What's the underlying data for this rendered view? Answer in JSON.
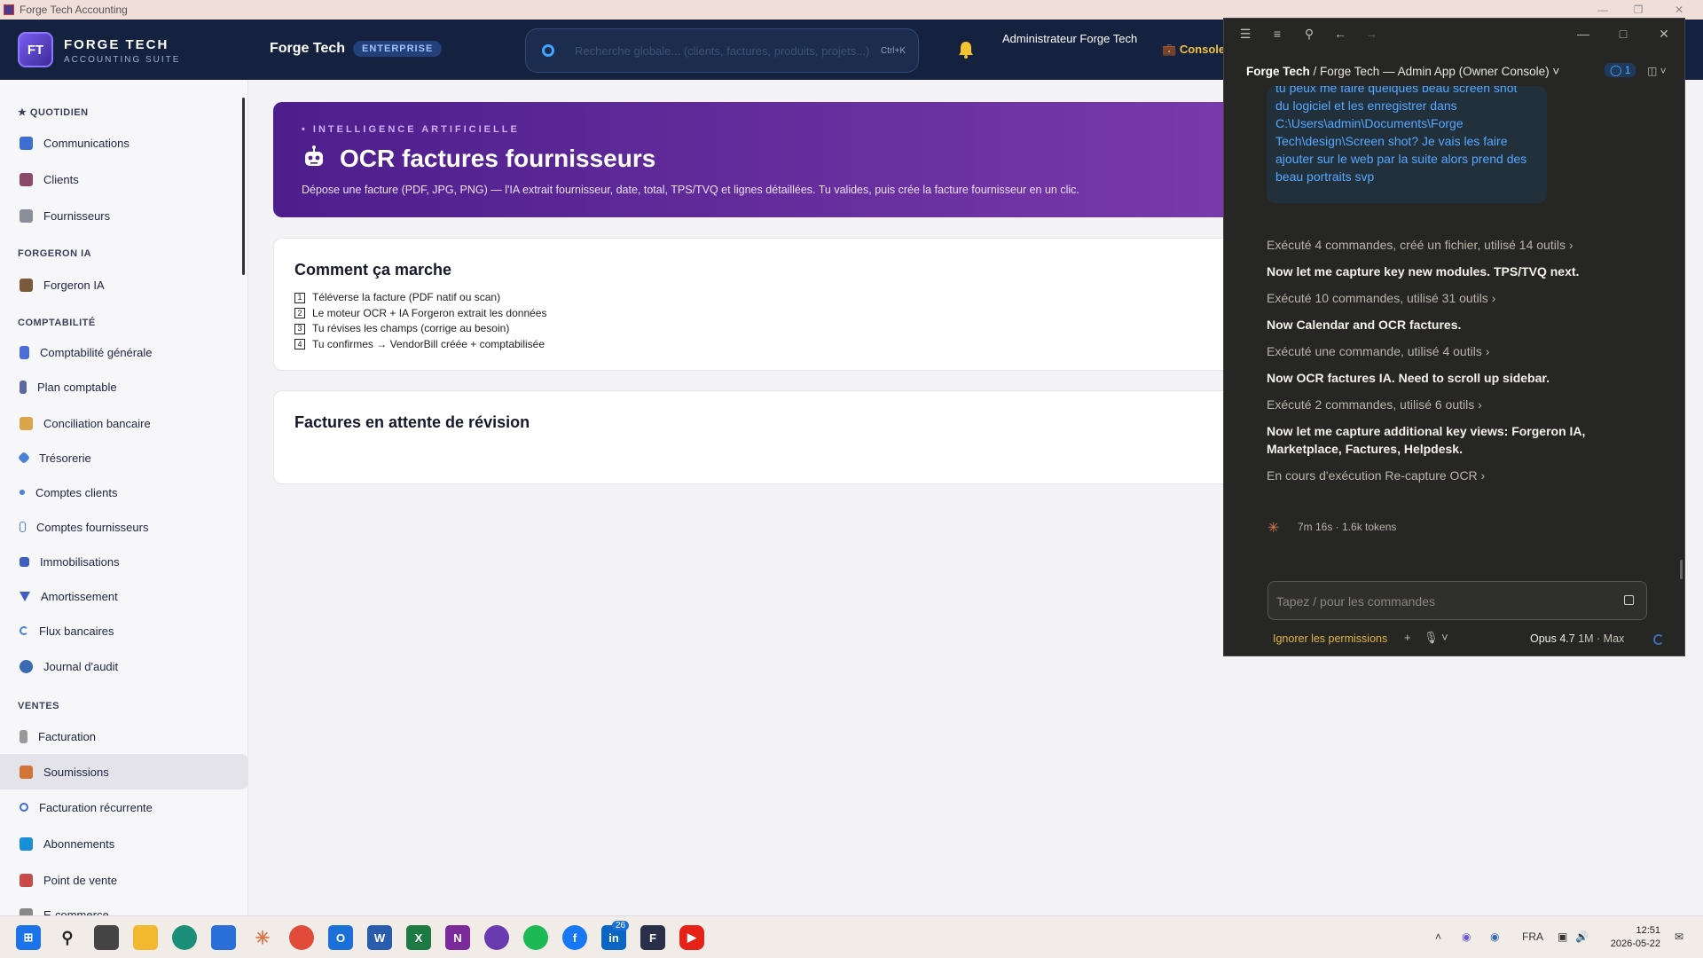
{
  "window": {
    "title": "Forge Tech Accounting"
  },
  "header": {
    "logo_title": "FORGE TECH",
    "logo_sub": "ACCOUNTING SUITE",
    "brand": "Forge Tech",
    "tier": "ENTERPRISE",
    "search_placeholder": "Recherche globale... (clients, factures, produits, projets...)",
    "search_shortcut": "Ctrl+K",
    "admin_name": "Administrateur Forge Tech",
    "console_label": "Console"
  },
  "sidebar": {
    "sections": [
      {
        "label": "★ QUOTIDIEN"
      },
      {
        "label": "FORGERON IA"
      },
      {
        "label": "COMPTABILITÉ"
      },
      {
        "label": "VENTES"
      }
    ],
    "items": [
      {
        "label": "Communications",
        "icon": "chat-icon",
        "color": "#3d6fd0"
      },
      {
        "label": "Clients",
        "icon": "users-icon",
        "color": "#8a4a6a"
      },
      {
        "label": "Fournisseurs",
        "icon": "building-icon",
        "color": "#8a8f9a"
      },
      {
        "label": "Forgeron IA",
        "icon": "hammer-icon",
        "color": "#7a5a3a"
      },
      {
        "label": "Comptabilité générale",
        "icon": "ledger-icon",
        "color": "#4a6fd8"
      },
      {
        "label": "Plan comptable",
        "icon": "list-icon",
        "color": "#5a6aa0"
      },
      {
        "label": "Conciliation bancaire",
        "icon": "scale-icon",
        "color": "#d9a44a"
      },
      {
        "label": "Trésorerie",
        "icon": "diamond-icon",
        "color": "#4a80d8"
      },
      {
        "label": "Comptes clients",
        "icon": "arrow-icon",
        "color": "#4a80d8"
      },
      {
        "label": "Comptes fournisseurs",
        "icon": "doc-icon",
        "color": "#4a80d8"
      },
      {
        "label": "Immobilisations",
        "icon": "block-icon",
        "color": "#3d5fc0"
      },
      {
        "label": "Amortissement",
        "icon": "triangle-down-icon",
        "color": "#3d5fc0"
      },
      {
        "label": "Flux bancaires",
        "icon": "refresh-icon",
        "color": "#4a80d8"
      },
      {
        "label": "Journal d'audit",
        "icon": "magnifier-icon",
        "color": "#3a6ab0"
      },
      {
        "label": "Facturation",
        "icon": "receipt-icon",
        "color": "#999"
      },
      {
        "label": "Soumissions",
        "icon": "memo-icon",
        "color": "#d0743a"
      },
      {
        "label": "Facturation récurrente",
        "icon": "recurring-icon",
        "color": "#3d6fd0"
      },
      {
        "label": "Abonnements",
        "icon": "subscription-icon",
        "color": "#1a8fd8"
      },
      {
        "label": "Point de vente",
        "icon": "pos-icon",
        "color": "#c84a4a"
      },
      {
        "label": "E-commerce",
        "icon": "cart-icon",
        "color": "#888"
      }
    ]
  },
  "hero": {
    "kicker": "• INTELLIGENCE ARTIFICIELLE",
    "title": "OCR factures fournisseurs",
    "desc": "Dépose une facture (PDF, JPG, PNG) — l'IA extrait fournisseur, date, total, TPS/TVQ et lignes détaillées. Tu valides, puis crée la facture fournisseur en un clic."
  },
  "how": {
    "title": "Comment ça marche",
    "steps": [
      {
        "n": "1",
        "text": "Téléverse la facture (PDF natif ou scan)"
      },
      {
        "n": "2",
        "text": "Le moteur OCR + IA Forgeron extrait les données"
      },
      {
        "n": "3",
        "text": "Tu révises les champs (corrige au besoin)"
      },
      {
        "n": "4",
        "text": "Tu confirmes → VendorBill créée + comptabilisée"
      }
    ]
  },
  "pending": {
    "title": "Factures en attente de révision"
  },
  "panel": {
    "crumb_org": "Forge Tech",
    "crumb_rest": " / Forge Tech — Admin App (Owner Console) ˅",
    "badge": "1",
    "user_message": "tu peux me faire quelques beau screen shot du logiciel et les enregistrer dans C:\\Users\\admin\\Documents\\Forge Tech\\design\\Screen shot? Je vais les faire ajouter sur le web par la suite alors prend des beau portraits svp",
    "log": [
      {
        "text": "Exécuté 4 commandes, créé un fichier, utilisé 14 outils ›",
        "style": "dim"
      },
      {
        "text": "Now let me capture key new modules. TPS/TVQ next.",
        "style": "bold"
      },
      {
        "text": "Exécuté 10 commandes, utilisé 31 outils ›",
        "style": "dim"
      },
      {
        "text": "Now Calendar and OCR factures.",
        "style": "bold"
      },
      {
        "text": "Exécuté une commande, utilisé 4 outils ›",
        "style": "dim"
      },
      {
        "text": "Now OCR factures IA. Need to scroll up sidebar.",
        "style": "bold"
      },
      {
        "text": "Exécuté 2 commandes, utilisé 6 outils ›",
        "style": "dim"
      },
      {
        "text": "Now let me capture additional key views: Forgeron IA,",
        "style": "bold"
      },
      {
        "text": "Marketplace, Factures, Helpdesk.",
        "style": "bold"
      },
      {
        "text": "En cours d'exécution Re-capture OCR ›",
        "style": "dim"
      }
    ],
    "meta": "7m 16s · 1.6k tokens",
    "input_placeholder": "Tapez / pour les commandes",
    "permissions": "Ignorer les permissions",
    "model_name": "Opus 4.7",
    "model_meta": " 1M · Max"
  },
  "taskbar": {
    "linkedin_badge": "26",
    "lang": "FRA",
    "time": "12:51",
    "date": "2026-05-22"
  }
}
